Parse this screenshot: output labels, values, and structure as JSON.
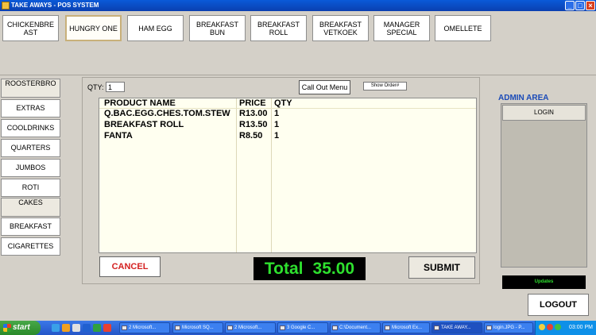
{
  "window": {
    "title": "TAKE AWAYS - POS SYSTEM",
    "controls": {
      "minimize": "_",
      "maximize": "□",
      "close": "×"
    }
  },
  "menu_items": [
    {
      "label": "CHICKENBRE AST"
    },
    {
      "label": "HUNGRY ONE"
    },
    {
      "label": "HAM EGG"
    },
    {
      "label": "BREAKFAST BUN"
    },
    {
      "label": "BREAKFAST ROLL"
    },
    {
      "label": "BREAKFAST VETKOEK"
    },
    {
      "label": "MANAGER SPECIAL"
    },
    {
      "label": "OMELLETE"
    }
  ],
  "categories": [
    {
      "label": "ROOSTERBRO"
    },
    {
      "label": "EXTRAS"
    },
    {
      "label": "COOLDRINKS"
    },
    {
      "label": "QUARTERS"
    },
    {
      "label": "JUMBOS"
    },
    {
      "label": "ROTI"
    },
    {
      "label": "CAKES"
    },
    {
      "label": "BREAKFAST"
    },
    {
      "label": "CIGARETTES"
    }
  ],
  "order": {
    "qty_label": "QTY:",
    "qty_value": "1",
    "callout_label": "Call Out Menu",
    "show_order_label": "Show Order#",
    "columns": [
      "PRODUCT NAME",
      "PRICE",
      "QTY"
    ],
    "rows": [
      {
        "name": "Q.BAC.EGG.CHES.TOM.STEW",
        "price": "R13.00",
        "qty": "1"
      },
      {
        "name": "BREAKFAST ROLL",
        "price": "R13.50",
        "qty": "1"
      },
      {
        "name": "FANTA",
        "price": "R8.50",
        "qty": "1"
      }
    ],
    "cancel_label": "CANCEL",
    "total_label": "Total",
    "total_value": "35.00",
    "submit_label": "SUBMIT"
  },
  "admin": {
    "title": "ADMIN AREA",
    "login_label": "LOGIN",
    "updates_label": "Updates",
    "logout_label": "LOGOUT"
  },
  "taskbar": {
    "start_label": "start",
    "tasks": [
      {
        "label": "2 Microsoft..."
      },
      {
        "label": "Microsoft SQ..."
      },
      {
        "label": "2 Microsoft..."
      },
      {
        "label": "3 Google C..."
      },
      {
        "label": "C:\\Document..."
      },
      {
        "label": "Microsoft Ex..."
      },
      {
        "label": "TAKE AWAY..."
      },
      {
        "label": "login.JPG - P..."
      }
    ],
    "clock": "03:00 PM"
  },
  "colors": {
    "accent_text": "#1a4ab8",
    "cancel_text": "#d42020",
    "total_text": "#2ee02e",
    "grid_bg": "#fffff0"
  }
}
